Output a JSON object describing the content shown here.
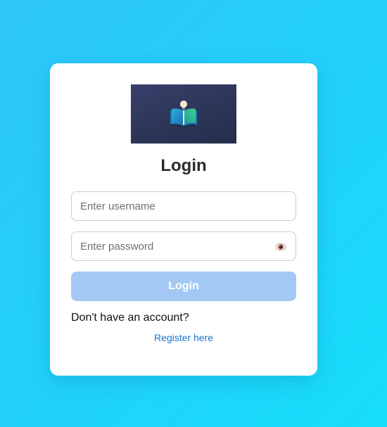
{
  "form": {
    "title": "Login",
    "username_placeholder": "Enter username",
    "password_placeholder": "Enter password",
    "login_button_label": "Login",
    "no_account_text": "Don't have an account?",
    "register_link_label": "Register here"
  },
  "icons": {
    "logo": "open-book-with-lightbulb-icon",
    "password_toggle": "eye-icon"
  },
  "colors": {
    "background_start": "#2ec6f8",
    "background_end": "#16def9",
    "card": "#ffffff",
    "logo_background": "#2c3556",
    "login_button": "#a3c8f3",
    "link": "#1a73c9"
  }
}
